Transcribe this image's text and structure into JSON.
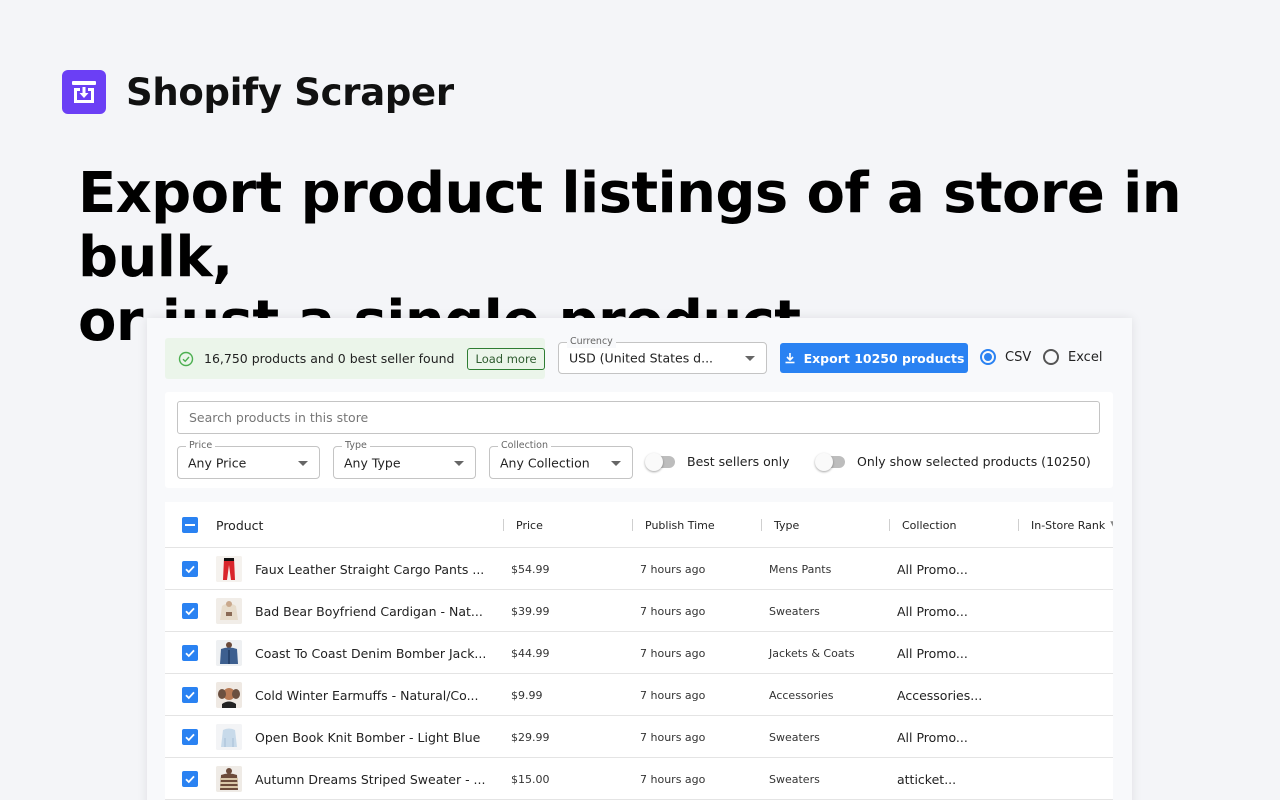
{
  "brand": {
    "name": "Shopify Scraper",
    "accent": "#6b3ff5"
  },
  "headline": {
    "line1": "Export product listings of a store in bulk,",
    "line2": "or just a single product"
  },
  "status": {
    "text": "16,750 products and 0 best seller found",
    "load_more_label": "Load more"
  },
  "currency": {
    "label": "Currency",
    "value": "USD (United States d..."
  },
  "export": {
    "label": "Export 10250 products",
    "accent": "#2a82f2"
  },
  "format": {
    "options": [
      {
        "label": "CSV",
        "selected": true
      },
      {
        "label": "Excel",
        "selected": false
      }
    ]
  },
  "search": {
    "placeholder": "Search products in this store"
  },
  "filters": {
    "price": {
      "label": "Price",
      "value": "Any Price"
    },
    "type": {
      "label": "Type",
      "value": "Any Type"
    },
    "collection": {
      "label": "Collection",
      "value": "Any Collection"
    }
  },
  "toggles": {
    "best_sellers": "Best sellers only",
    "only_selected": "Only show selected products (10250)"
  },
  "table": {
    "columns": {
      "product": "Product",
      "price": "Price",
      "publish_time": "Publish Time",
      "type": "Type",
      "collection": "Collection",
      "rank": "In-Store Rank"
    },
    "rows": [
      {
        "name": "Faux Leather Straight Cargo Pants ...",
        "price": "$54.99",
        "time": "7 hours ago",
        "type": "Mens Pants",
        "collection": "All Promo...",
        "thumb": "red-pants"
      },
      {
        "name": "Bad Bear Boyfriend Cardigan - Nat...",
        "price": "$39.99",
        "time": "7 hours ago",
        "type": "Sweaters",
        "collection": "All Promo...",
        "thumb": "cream-cardigan"
      },
      {
        "name": "Coast To Coast Denim Bomber Jack...",
        "price": "$44.99",
        "time": "7 hours ago",
        "type": "Jackets & Coats",
        "collection": "All Promo...",
        "thumb": "denim-jacket"
      },
      {
        "name": "Cold Winter Earmuffs - Natural/Co...",
        "price": "$9.99",
        "time": "7 hours ago",
        "type": "Accessories",
        "collection": "Accessories...",
        "thumb": "earmuffs"
      },
      {
        "name": "Open Book Knit Bomber - Light Blue",
        "price": "$29.99",
        "time": "7 hours ago",
        "type": "Sweaters",
        "collection": "All Promo...",
        "thumb": "light-blue-bomber"
      },
      {
        "name": "Autumn Dreams Striped Sweater - ...",
        "price": "$15.00",
        "time": "7 hours ago",
        "type": "Sweaters",
        "collection": "atticket...",
        "thumb": "striped-sweater"
      }
    ]
  }
}
